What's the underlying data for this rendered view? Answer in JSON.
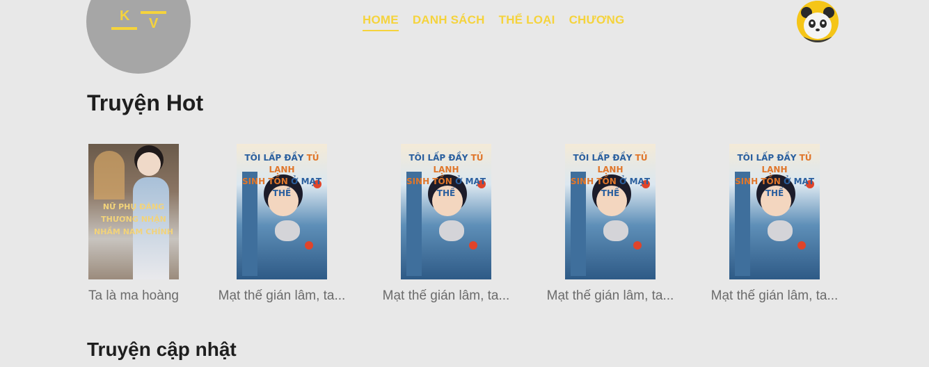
{
  "logo": {
    "letter1": "K",
    "letter2": "V"
  },
  "nav": {
    "items": [
      {
        "label": "HOME"
      },
      {
        "label": "DANH SÁCH"
      },
      {
        "label": "THỂ LOẠI"
      },
      {
        "label": "CHƯƠNG"
      }
    ]
  },
  "sections": {
    "hot": "Truyện Hot",
    "updated": "Truyện cập nhật"
  },
  "books": [
    {
      "name": "Ta là ma hoàng",
      "cover_text": "NỮ PHỤ ĐÁNG THƯƠNG NHẬN NHẦM NAM CHÍNH"
    },
    {
      "name": "Mạt thế gián lâm, ta...",
      "cover_text_1": "TÔI LẤP ĐẦY",
      "cover_text_2": "TỦ LẠNH",
      "cover_text_3": "SINH TỒN",
      "cover_text_4": "Ở MẠT THẾ"
    },
    {
      "name": "Mạt thế gián lâm, ta...",
      "cover_text_1": "TÔI LẤP ĐẦY",
      "cover_text_2": "TỦ LẠNH",
      "cover_text_3": "SINH TỒN",
      "cover_text_4": "Ở MẠT THẾ"
    },
    {
      "name": "Mạt thế gián lâm, ta...",
      "cover_text_1": "TÔI LẤP ĐẦY",
      "cover_text_2": "TỦ LẠNH",
      "cover_text_3": "SINH TỒN",
      "cover_text_4": "Ở MẠT THẾ"
    },
    {
      "name": "Mạt thế gián lâm, ta...",
      "cover_text_1": "TÔI LẤP ĐẦY",
      "cover_text_2": "TỦ LẠNH",
      "cover_text_3": "SINH TỒN",
      "cover_text_4": "Ở MẠT THẾ"
    }
  ],
  "colors": {
    "accent": "#f5d33c",
    "background": "#e8e8e8",
    "logo_bg": "#a6a6a6"
  },
  "icons": {
    "avatar": "panda-avatar-icon"
  }
}
